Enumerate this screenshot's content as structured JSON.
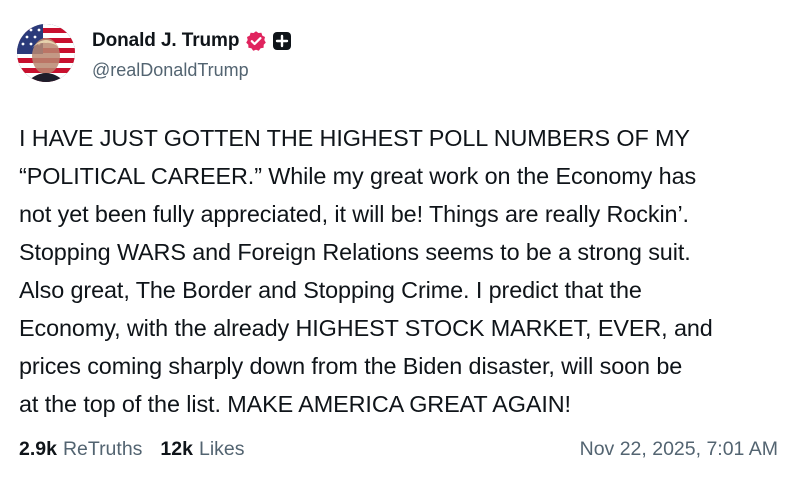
{
  "author": {
    "display_name": "Donald J. Trump",
    "handle": "@realDonaldTrump",
    "avatar_icon": "profile-photo-flag-icon",
    "verified_icon": "verified-badge-icon",
    "extra_badge_icon": "plus-badge-icon",
    "verified_color": "#e0245e"
  },
  "post": {
    "lines": [
      "I HAVE JUST GOTTEN THE HIGHEST POLL NUMBERS OF MY",
      "“POLITICAL CAREER.” While my great work on the Economy has",
      "not yet been fully appreciated, it will be! Things are really Rockin’.",
      "Stopping WARS and Foreign Relations seems to be a strong suit.",
      "Also great, The Border and Stopping Crime. I predict that the",
      "Economy, with the already HIGHEST STOCK MARKET, EVER, and",
      "prices coming sharply down from the Biden disaster, will soon be",
      "at the top of the list. MAKE AMERICA GREAT AGAIN!"
    ]
  },
  "stats": {
    "retruths_count": "2.9k",
    "retruths_label": "ReTruths",
    "likes_count": "12k",
    "likes_label": "Likes",
    "timestamp": "Nov 22, 2025, 7:01 AM"
  },
  "colors": {
    "text_primary": "#0f1419",
    "text_secondary": "#536471",
    "background": "#ffffff"
  }
}
